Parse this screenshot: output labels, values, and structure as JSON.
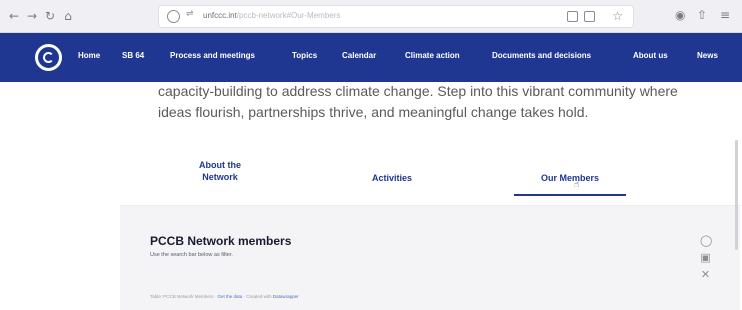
{
  "browser": {
    "url_domain": "unfccc.int",
    "url_path": "/pccb-network#Our-Members",
    "icons": [
      "back-icon",
      "forward-icon",
      "reload-icon",
      "home-icon",
      "shield-icon",
      "lock-icon",
      "reader-icon",
      "extension-icon",
      "star-icon",
      "account-icon",
      "share-icon",
      "menu-icon"
    ]
  },
  "site_nav": {
    "logo": "unfccc-logo",
    "items": [
      "Home",
      "SB 64",
      "Process and meetings",
      "Topics",
      "Calendar",
      "Climate action",
      "Documents and decisions",
      "About us",
      "News"
    ],
    "bg_color": "#1f3791"
  },
  "intro": {
    "line1": "capacity-building to address climate change. Step into this vibrant community where",
    "line2": "ideas flourish, partnerships thrive, and meaningful change takes hold."
  },
  "tabs": {
    "about_line1": "About the",
    "about_line2": "Network",
    "activities": "Activities",
    "members": "Our Members",
    "active": "Our Members"
  },
  "members_panel": {
    "title": "PCCB Network members",
    "subtitle": "Use the search bar below as filter.",
    "source_prefix": "Table: PCCB Network Members · ",
    "source_link": "Get the data",
    "source_mid": " · Created with ",
    "source_tool": "Datawrapper"
  },
  "social_icons": [
    "github-icon",
    "facebook-icon",
    "x-icon"
  ]
}
